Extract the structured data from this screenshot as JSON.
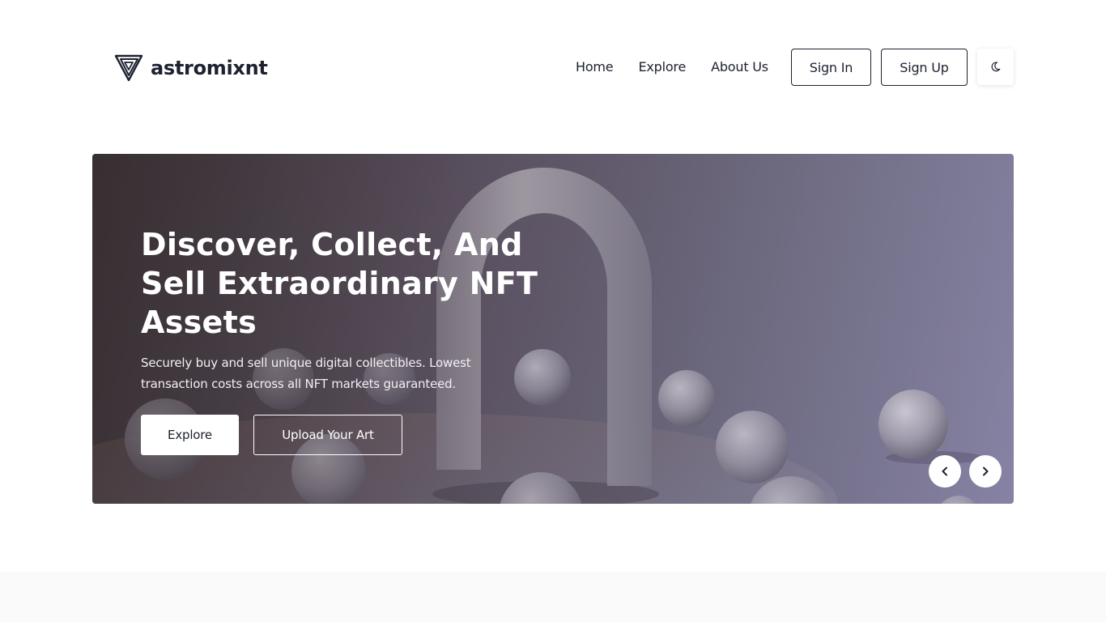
{
  "header": {
    "logo_text": "astromixnt",
    "logo_icon": "triangle-shield-logo",
    "nav": [
      {
        "label": "Home"
      },
      {
        "label": "Explore"
      },
      {
        "label": "About Us"
      }
    ],
    "signin_label": "Sign In",
    "signup_label": "Sign Up",
    "theme_toggle_icon": "moon-icon"
  },
  "hero": {
    "title": "Discover, Collect, And Sell Extraordinary NFT Assets",
    "description": "Securely buy and sell unique digital collectibles. Lowest transaction costs across all NFT markets guaranteed.",
    "explore_label": "Explore",
    "upload_label": "Upload Your Art",
    "prev_icon": "chevron-left-icon",
    "next_icon": "chevron-right-icon"
  },
  "colors": {
    "text_dark": "#1d2130",
    "white": "#ffffff",
    "section_bg": "#fafafa"
  }
}
